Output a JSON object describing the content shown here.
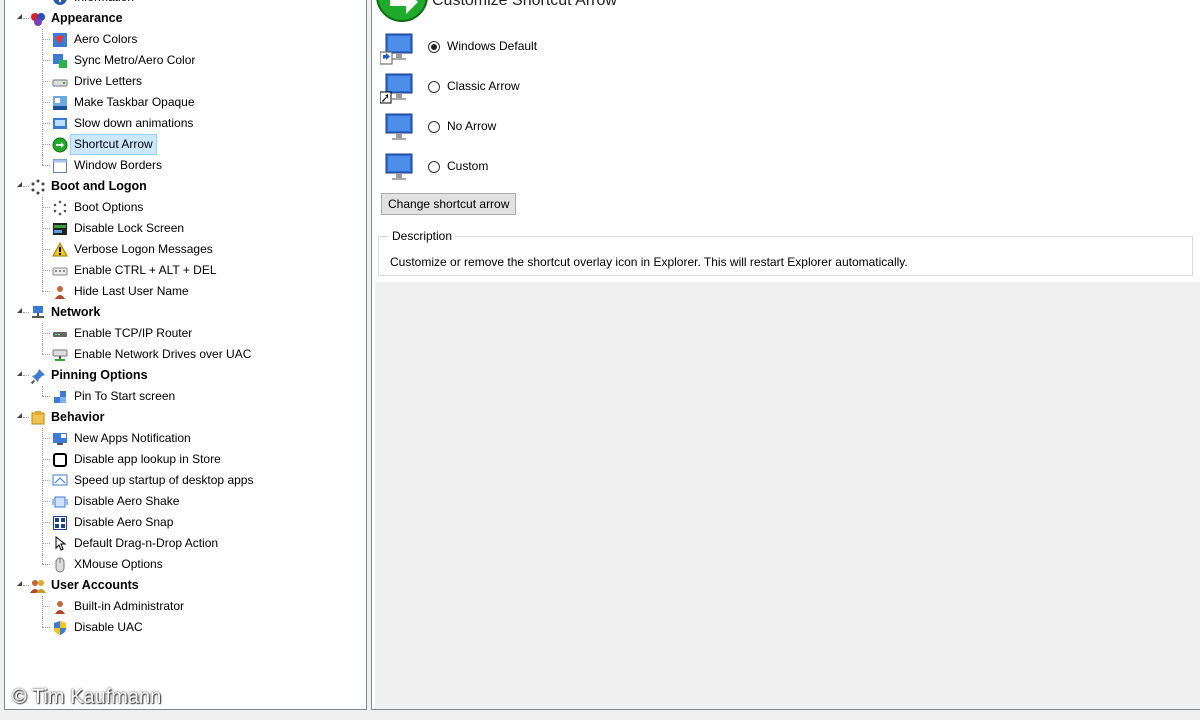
{
  "tree": {
    "groups": [
      {
        "label": "",
        "icon": "info-icon",
        "items": [
          {
            "label": "Information",
            "icon": "info-icon"
          }
        ],
        "hidden_header": true
      },
      {
        "label": "Appearance",
        "icon": "appearance-icon",
        "items": [
          {
            "label": "Aero Colors",
            "icon": "aero-colors-icon"
          },
          {
            "label": "Sync Metro/Aero Color",
            "icon": "sync-color-icon"
          },
          {
            "label": "Drive Letters",
            "icon": "drive-icon"
          },
          {
            "label": "Make Taskbar Opaque",
            "icon": "taskbar-icon"
          },
          {
            "label": "Slow down animations",
            "icon": "animation-icon"
          },
          {
            "label": "Shortcut Arrow",
            "icon": "shortcut-arrow-icon",
            "selected": true
          },
          {
            "label": "Window Borders",
            "icon": "window-borders-icon"
          }
        ]
      },
      {
        "label": "Boot and Logon",
        "icon": "boot-icon",
        "items": [
          {
            "label": "Boot Options",
            "icon": "boot-options-icon"
          },
          {
            "label": "Disable Lock Screen",
            "icon": "lock-screen-icon"
          },
          {
            "label": "Verbose Logon Messages",
            "icon": "verbose-icon"
          },
          {
            "label": "Enable CTRL + ALT + DEL",
            "icon": "keyboard-icon"
          },
          {
            "label": "Hide Last User Name",
            "icon": "user-icon"
          }
        ]
      },
      {
        "label": "Network",
        "icon": "network-icon",
        "items": [
          {
            "label": "Enable TCP/IP Router",
            "icon": "router-icon"
          },
          {
            "label": "Enable Network Drives over UAC",
            "icon": "network-drive-icon"
          }
        ]
      },
      {
        "label": "Pinning Options",
        "icon": "pin-icon",
        "items": [
          {
            "label": "Pin To Start screen",
            "icon": "pin-start-icon"
          }
        ]
      },
      {
        "label": "Behavior",
        "icon": "behavior-icon",
        "items": [
          {
            "label": "New Apps Notification",
            "icon": "notification-icon"
          },
          {
            "label": "Disable app lookup in Store",
            "icon": "store-icon"
          },
          {
            "label": "Speed up startup of desktop apps",
            "icon": "startup-icon"
          },
          {
            "label": "Disable Aero Shake",
            "icon": "aero-shake-icon"
          },
          {
            "label": "Disable Aero Snap",
            "icon": "aero-snap-icon"
          },
          {
            "label": "Default Drag-n-Drop Action",
            "icon": "drag-drop-icon"
          },
          {
            "label": "XMouse Options",
            "icon": "mouse-icon"
          }
        ]
      },
      {
        "label": "User Accounts",
        "icon": "users-icon",
        "items": [
          {
            "label": "Built-in Administrator",
            "icon": "admin-icon"
          },
          {
            "label": "Disable UAC",
            "icon": "uac-shield-icon"
          }
        ]
      }
    ]
  },
  "content": {
    "title": "Customize Shortcut Arrow",
    "options": [
      {
        "label": "Windows Default",
        "checked": true,
        "icon": "windows-default-arrow-icon"
      },
      {
        "label": "Classic Arrow",
        "checked": false,
        "icon": "classic-arrow-icon"
      },
      {
        "label": "No Arrow",
        "checked": false,
        "icon": "no-arrow-icon"
      },
      {
        "label": "Custom",
        "checked": false,
        "icon": "custom-arrow-icon"
      }
    ],
    "change_button": "Change shortcut arrow",
    "description": {
      "legend": "Description",
      "text": "Customize or remove the shortcut overlay icon in Explorer. This will restart Explorer automatically."
    }
  },
  "watermark": "© Tim Kaufmann",
  "colors": {
    "selection_bg": "#cce8ff",
    "selection_border": "#99d1ff",
    "header_icon_green": "#1faa2b"
  }
}
